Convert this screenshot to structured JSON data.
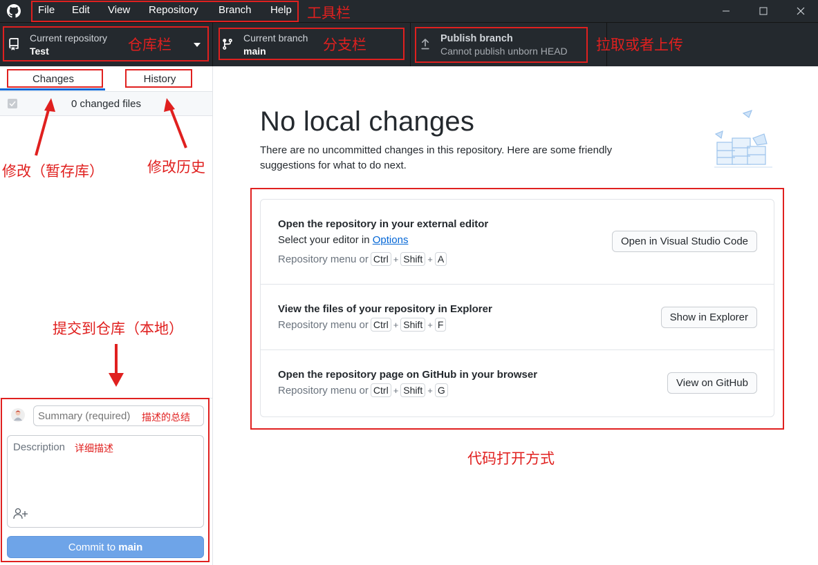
{
  "menu": {
    "items": [
      "File",
      "Edit",
      "View",
      "Repository",
      "Branch",
      "Help"
    ]
  },
  "toolbar": {
    "repo_label": "Current repository",
    "repo_value": "Test",
    "branch_label": "Current branch",
    "branch_value": "main",
    "publish_label": "Publish branch",
    "publish_value": "Cannot publish unborn HEAD"
  },
  "sidebar": {
    "tab_changes": "Changes",
    "tab_history": "History",
    "changed_files": "0 changed files",
    "summary_placeholder": "Summary (required)",
    "description_placeholder": "Description",
    "commit_prefix": "Commit to ",
    "commit_branch": "main"
  },
  "main": {
    "title": "No local changes",
    "subtitle": "There are no uncommitted changes in this repository. Here are some friendly suggestions for what to do next.",
    "suggestions": [
      {
        "title": "Open the repository in your external editor",
        "line_prefix": "Select your editor in ",
        "line_link": "Options",
        "shortcut_prefix": "Repository menu or",
        "keys": [
          "Ctrl",
          "Shift",
          "A"
        ],
        "button": "Open in Visual Studio Code"
      },
      {
        "title": "View the files of your repository in Explorer",
        "shortcut_prefix": "Repository menu or",
        "keys": [
          "Ctrl",
          "Shift",
          "F"
        ],
        "button": "Show in Explorer"
      },
      {
        "title": "Open the repository page on GitHub in your browser",
        "shortcut_prefix": "Repository menu or",
        "keys": [
          "Ctrl",
          "Shift",
          "G"
        ],
        "button": "View on GitHub"
      }
    ]
  },
  "annotations": {
    "toolbar_menu": "工具栏",
    "repo_bar": "仓库栏",
    "branch_bar": "分支栏",
    "pull_push": "拉取或者上传",
    "changes_staging": "修改（暂存库）",
    "history": "修改历史",
    "commit_local": "提交到仓库（本地）",
    "summary_note": "描述的总结",
    "description_note": "详细描述",
    "open_code": "代码打开方式"
  },
  "colors": {
    "titlebar_bg": "#24292e",
    "accent": "#0366d6",
    "commit_button": "#6ea4e8",
    "annotation_red": "#e0201f"
  }
}
